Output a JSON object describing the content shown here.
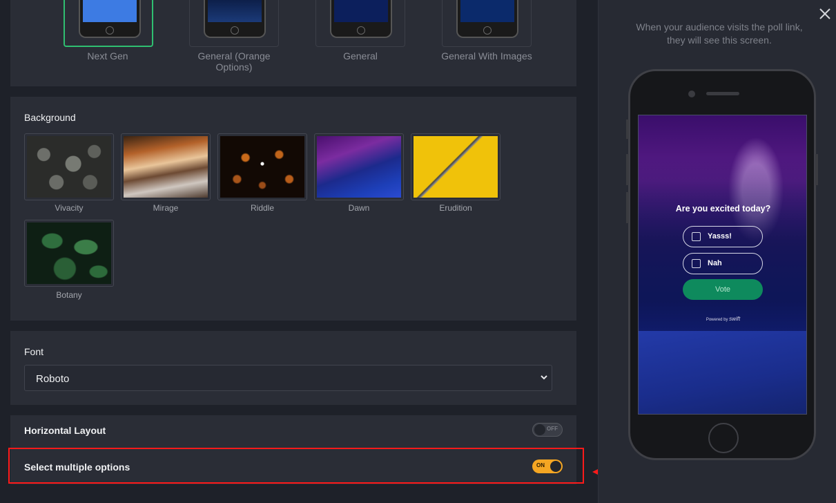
{
  "themes": [
    {
      "label": "Next Gen",
      "selected": true,
      "screen_color": "#3d7be3"
    },
    {
      "label": "General (Orange Options)",
      "selected": false,
      "screen_color": "#10265a"
    },
    {
      "label": "General",
      "selected": false,
      "screen_color": "#0c1f5c"
    },
    {
      "label": "General With Images",
      "selected": false,
      "screen_color": "#0b2a6b"
    }
  ],
  "background": {
    "title": "Background",
    "items": [
      {
        "label": "Vivacity"
      },
      {
        "label": "Mirage"
      },
      {
        "label": "Riddle"
      },
      {
        "label": "Dawn"
      },
      {
        "label": "Erudition"
      },
      {
        "label": "Botany"
      }
    ]
  },
  "font": {
    "title": "Font",
    "value": "Roboto"
  },
  "horizontal_layout": {
    "label": "Horizontal Layout",
    "state_text": "OFF",
    "on": false
  },
  "select_multiple": {
    "label": "Select multiple options",
    "state_text": "ON",
    "on": true
  },
  "annotation": {
    "highlight_color": "#ff1a1a"
  },
  "preview": {
    "description": "When your audience visits the poll link, they will see this screen.",
    "question": "Are you excited today?",
    "options": [
      "Yasss!",
      "Nah"
    ],
    "vote_label": "Vote",
    "powered_by": "Powered by",
    "brand": "swift"
  },
  "colors": {
    "accent": "#f5a623",
    "selected_border": "#2fbf71",
    "vote_button": "#0e8a5d"
  }
}
